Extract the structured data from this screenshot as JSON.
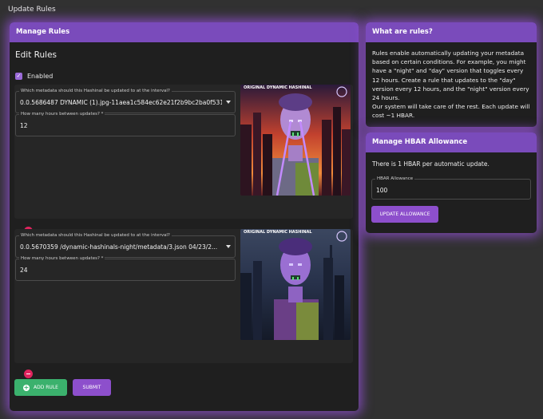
{
  "page": {
    "title": "Update Rules"
  },
  "manage": {
    "header": "Manage Rules",
    "section_title": "Edit Rules",
    "enabled_label": "Enabled",
    "enabled": true,
    "rules": [
      {
        "metadata_label": "Which metadata should this Hashinal be updated to at the interval?",
        "metadata_value": "0.0.5686487 DYNAMIC (1).jpg-11aea1c584ec62e21f2b9bc2ba0f5315...",
        "hours_label": "How many hours between updates? *",
        "hours_value": "12",
        "image_caption": "ORIGINAL DYNAMIC HASHINAL",
        "image_theme": "day"
      },
      {
        "metadata_label": "Which metadata should this Hashinal be updated to at the interval?",
        "metadata_value": "0.0.5670359 /dynamic-hashinals-night/metadata/3.json 04/23/2...",
        "hours_label": "How many hours between updates? *",
        "hours_value": "24",
        "image_caption": "ORIGINAL DYNAMIC HASHINAL",
        "image_theme": "night"
      }
    ],
    "add_rule_label": "ADD RULE",
    "submit_label": "SUBMIT"
  },
  "about": {
    "header": "What are rules?",
    "paragraph_1": "Rules enable automatically updating your metadata based on certain conditions. For example, you might have a \"night\" and \"day\" version that toggles every 12 hours. Create a rule that updates to the \"day\" version every 12 hours, and the \"night\" version every 24 hours.",
    "paragraph_2": "Our system will take care of the rest. Each update will cost ~1 HBAR."
  },
  "allowance": {
    "header": "Manage HBAR Allowance",
    "info": "There is 1 HBAR per automatic update.",
    "field_label": "HBAR Allowance",
    "field_value": "100",
    "button_label": "UPDATE ALLOWANCE"
  },
  "colors": {
    "accent": "#7a4bbb",
    "button_purple": "#8d4fcc",
    "button_green": "#3bb16d",
    "remove_red": "#e0245e",
    "card_bg": "#1f1f1f",
    "page_bg": "#313131"
  },
  "icons": [
    "chevron-down-icon",
    "remove-icon",
    "plus-icon",
    "check-icon",
    "hashgraph-logo-icon"
  ]
}
